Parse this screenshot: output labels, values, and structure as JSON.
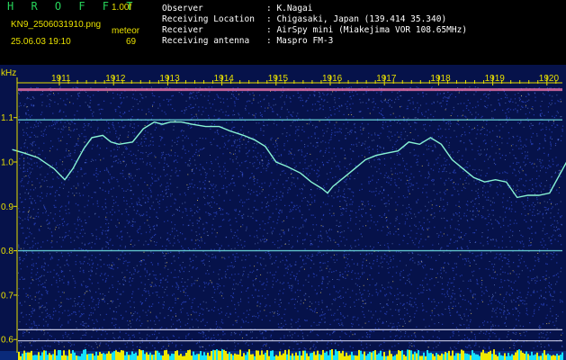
{
  "header": {
    "brand": "H R O F F T",
    "version": "1.00f",
    "filename": "KN9_2506031910.png",
    "timestamp": "25.06.03 19:10",
    "meteor_label": "meteor",
    "meteor_count": "69",
    "info": [
      {
        "key": "Observer",
        "value": ": K.Nagai"
      },
      {
        "key": "Receiving Location",
        "value": ": Chigasaki, Japan (139.414 35.340)"
      },
      {
        "key": "Receiver",
        "value": ": AirSpy mini (Miakejima VOR 108.65MHz)"
      },
      {
        "key": "Receiving antenna",
        "value": ": Maspro FM-3"
      }
    ]
  },
  "colors": {
    "background": "#06124a",
    "noise": "#3c5cff",
    "trace": "#88f4d4",
    "label": "#e8e000",
    "bottom_bar": "#14e0ff"
  },
  "chart_data": {
    "type": "line",
    "title": "",
    "xlabel": "",
    "ylabel": "kHz",
    "ylim": [
      0.57,
      1.175
    ],
    "x_ticks": [
      "1911",
      "1912",
      "1913",
      "1914",
      "1915",
      "1916",
      "1917",
      "1918",
      "1919",
      "1920"
    ],
    "y_ticks": [
      "1.1",
      "1.0",
      "0.9",
      "0.8",
      "0.7",
      "0.6"
    ],
    "x_domain_minutes": [
      10.13,
      20.43
    ],
    "series": [
      {
        "name": "",
        "x": [
          10.13,
          10.35,
          10.6,
          10.9,
          11.1,
          11.25,
          11.45,
          11.6,
          11.8,
          11.95,
          12.1,
          12.35,
          12.55,
          12.75,
          12.9,
          13.05,
          13.25,
          13.45,
          13.7,
          13.95,
          14.15,
          14.4,
          14.6,
          14.8,
          15.0,
          15.2,
          15.45,
          15.65,
          15.85,
          15.95,
          16.05,
          16.25,
          16.45,
          16.65,
          16.85,
          17.05,
          17.25,
          17.45,
          17.65,
          17.85,
          18.05,
          18.25,
          18.45,
          18.65,
          18.85,
          19.05,
          19.25,
          19.45,
          19.65,
          19.85,
          20.05,
          20.25,
          20.43
        ],
        "y": [
          1.028,
          1.02,
          1.01,
          0.985,
          0.96,
          0.985,
          1.03,
          1.055,
          1.06,
          1.045,
          1.04,
          1.045,
          1.075,
          1.09,
          1.085,
          1.09,
          1.09,
          1.085,
          1.08,
          1.08,
          1.07,
          1.06,
          1.05,
          1.035,
          1.0,
          0.99,
          0.975,
          0.955,
          0.94,
          0.93,
          0.945,
          0.965,
          0.985,
          1.005,
          1.015,
          1.02,
          1.025,
          1.045,
          1.04,
          1.055,
          1.04,
          1.005,
          0.985,
          0.965,
          0.955,
          0.96,
          0.955,
          0.92,
          0.925,
          0.925,
          0.93,
          0.975,
          1.015
        ]
      }
    ],
    "reference_lines": [
      1.163,
      1.095,
      0.8,
      0.622,
      0.597
    ],
    "grid": false
  }
}
